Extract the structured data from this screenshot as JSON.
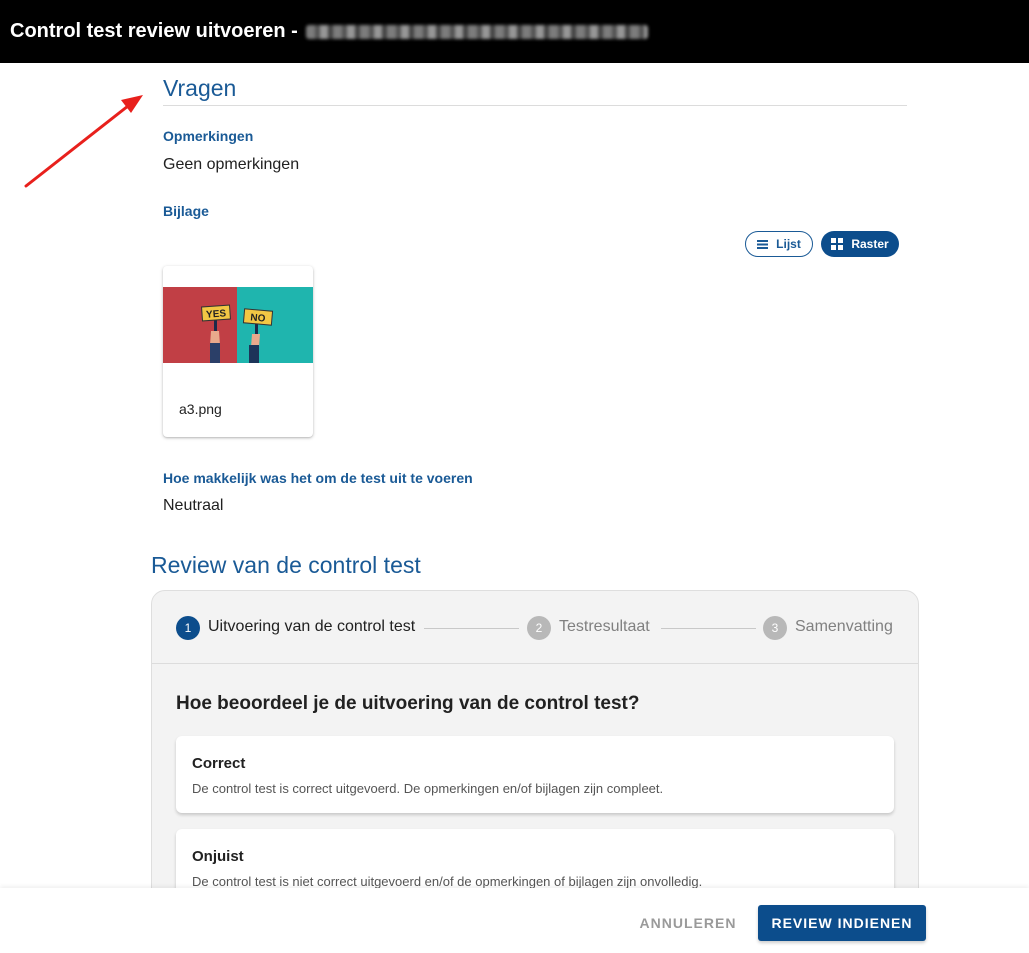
{
  "header": {
    "title": "Control test review uitvoeren - ",
    "title_redacted": true
  },
  "questions_section": {
    "title": "Vragen",
    "remarks_label": "Opmerkingen",
    "remarks_value": "Geen opmerkingen",
    "attachment_label": "Bijlage",
    "view_list_label": "Lijst",
    "view_grid_label": "Raster",
    "active_view": "Raster",
    "attachment": {
      "filename": "a3.png",
      "thumbnail": {
        "left_sign": "YES",
        "right_sign": "NO"
      }
    },
    "ease_label": "Hoe makkelijk was het om de test uit te voeren",
    "ease_value": "Neutraal"
  },
  "review_section": {
    "title": "Review van de control test",
    "steps": [
      {
        "number": "1",
        "label": "Uitvoering van de control test",
        "active": true
      },
      {
        "number": "2",
        "label": "Testresultaat",
        "active": false
      },
      {
        "number": "3",
        "label": "Samenvatting",
        "active": false
      }
    ],
    "question": "Hoe beoordeel je de uitvoering van de control test?",
    "options": [
      {
        "title": "Correct",
        "description": "De control test is correct uitgevoerd. De opmerkingen en/of bijlagen zijn compleet."
      },
      {
        "title": "Onjuist",
        "description": "De control test is niet correct uitgevoerd en/of de opmerkingen of bijlagen zijn onvolledig."
      }
    ]
  },
  "footer": {
    "cancel_label": "ANNULEREN",
    "submit_label": "REVIEW INDIENEN"
  },
  "colors": {
    "accent": "#1a5a96",
    "primary_button": "#0c4d8c",
    "annotation_arrow": "#e8201c"
  }
}
